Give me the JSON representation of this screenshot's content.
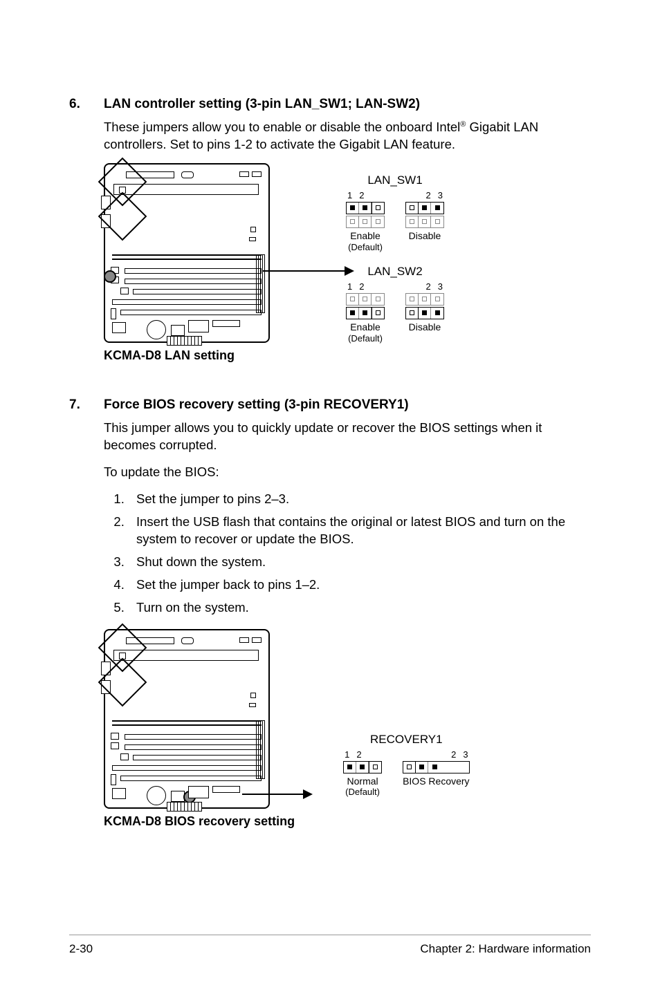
{
  "section6": {
    "number": "6.",
    "title": "LAN controller setting (3-pin LAN_SW1; LAN-SW2)",
    "body_pre": "These jumpers allow you to enable or disable the onboard Intel",
    "reg": "®",
    "body_post": " Gigabit LAN controllers. Set to pins 1-2 to activate the Gigabit LAN feature.",
    "caption": "KCMA-D8 LAN setting",
    "jumper1": {
      "title": "LAN_SW1",
      "left_pins": "1  2",
      "right_pins": "2  3",
      "left_label": "Enable",
      "left_sub": "(Default)",
      "right_label": "Disable"
    },
    "jumper2": {
      "title": "LAN_SW2",
      "left_pins": "1  2",
      "right_pins": "2  3",
      "left_label": "Enable",
      "left_sub": "(Default)",
      "right_label": "Disable"
    }
  },
  "section7": {
    "number": "7.",
    "title": "Force BIOS recovery setting (3-pin RECOVERY1)",
    "body1": "This jumper allows you to quickly update or recover the BIOS settings when it becomes corrupted.",
    "body2": "To update the BIOS:",
    "steps": [
      "Set the jumper to pins 2–3.",
      "Insert the USB flash that contains the original or latest BIOS and turn on the system to recover or update the BIOS.",
      "Shut down the system.",
      "Set the jumper back to pins 1–2.",
      "Turn on the system."
    ],
    "caption": "KCMA-D8 BIOS recovery setting",
    "jumper": {
      "title": "RECOVERY1",
      "left_pins": "1  2",
      "right_pins": "2  3",
      "left_label": "Normal",
      "left_sub": "(Default)",
      "right_label": "BIOS Recovery"
    }
  },
  "footer": {
    "page": "2-30",
    "chapter": "Chapter 2: Hardware information"
  }
}
